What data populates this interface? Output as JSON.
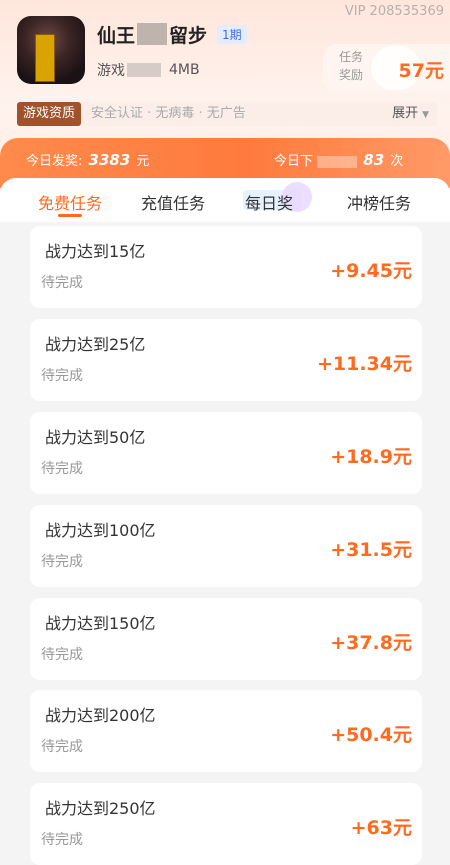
{
  "header": {
    "vip_id": "VIP 208535369",
    "game_title_prefix": "仙王",
    "game_title_suffix": "留步",
    "issue_badge": "1期",
    "meta_prefix": "游戏",
    "meta_size": "4MB",
    "reward_label": "任务奖励",
    "reward_amount": "57元",
    "qualification_tag": "游戏资质",
    "qualification_text": "安全认证 · 无病毒 · 无广告",
    "expand_label": "展开"
  },
  "stats": {
    "left_label": "今日发奖:",
    "left_value": "3383",
    "left_unit": "元",
    "right_label": "今日下",
    "right_value": "83",
    "right_unit": "次"
  },
  "tabs": [
    {
      "label": "免费任务",
      "active": true
    },
    {
      "label": "充值任务",
      "active": false
    },
    {
      "label": "每日奖",
      "active": false
    },
    {
      "label": "冲榜任务",
      "active": false
    }
  ],
  "tasks": [
    {
      "name": "战力达到15亿",
      "status": "待完成",
      "reward": "+9.45元"
    },
    {
      "name": "战力达到25亿",
      "status": "待完成",
      "reward": "+11.34元"
    },
    {
      "name": "战力达到50亿",
      "status": "待完成",
      "reward": "+18.9元"
    },
    {
      "name": "战力达到100亿",
      "status": "待完成",
      "reward": "+31.5元"
    },
    {
      "name": "战力达到150亿",
      "status": "待完成",
      "reward": "+37.8元"
    },
    {
      "name": "战力达到200亿",
      "status": "待完成",
      "reward": "+50.4元"
    },
    {
      "name": "战力达到250亿",
      "status": "待完成",
      "reward": "+63元"
    }
  ],
  "colors": {
    "accent": "#ff6a1f",
    "badge": "#a0522d"
  }
}
